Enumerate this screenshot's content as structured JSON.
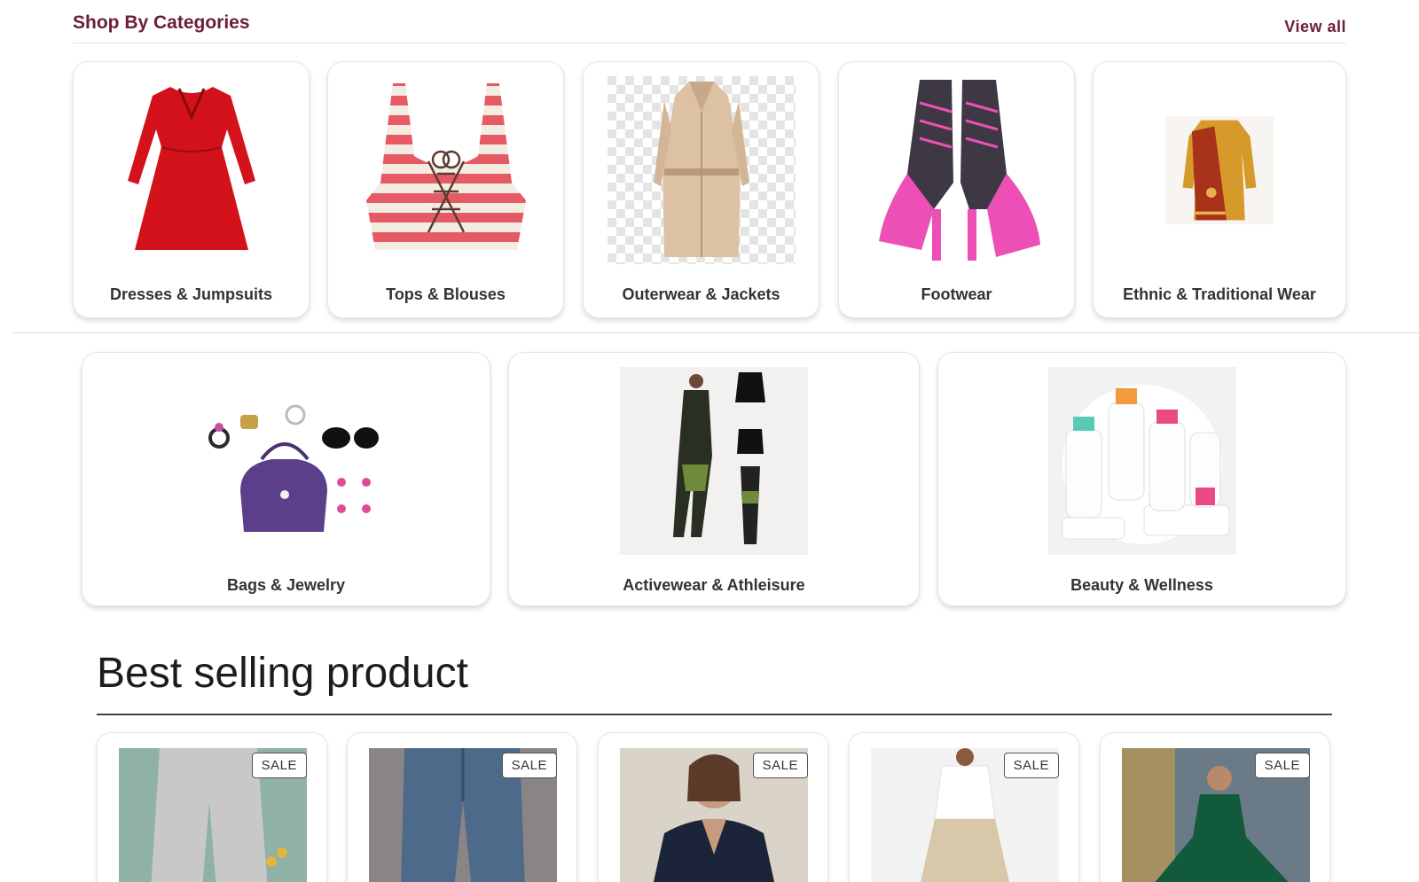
{
  "categories_section": {
    "title": "Shop By Categories",
    "view_all": "View all"
  },
  "categories": [
    {
      "label": "Dresses & Jumpsuits",
      "icon": "red-dress-icon"
    },
    {
      "label": "Tops & Blouses",
      "icon": "striped-top-icon"
    },
    {
      "label": "Outerwear & Jackets",
      "icon": "trench-coat-icon"
    },
    {
      "label": "Footwear",
      "icon": "boots-icon"
    },
    {
      "label": "Ethnic & Traditional Wear",
      "icon": "kurta-icon"
    },
    {
      "label": "Bags & Jewelry",
      "icon": "bag-jewelry-icon"
    },
    {
      "label": "Activewear & Athleisure",
      "icon": "activewear-icon"
    },
    {
      "label": "Beauty & Wellness",
      "icon": "beauty-bottles-icon"
    }
  ],
  "best_selling": {
    "title": "Best selling product",
    "products": [
      {
        "badge": "SALE",
        "image": "grey-trousers-photo"
      },
      {
        "badge": "SALE",
        "image": "blue-jeans-photo"
      },
      {
        "badge": "SALE",
        "image": "navy-blazer-photo"
      },
      {
        "badge": "SALE",
        "image": "satin-skirt-photo"
      },
      {
        "badge": "SALE",
        "image": "green-gown-photo"
      }
    ]
  },
  "colors": {
    "accent": "#6b1d3a",
    "divider": "#cfe5e1"
  }
}
